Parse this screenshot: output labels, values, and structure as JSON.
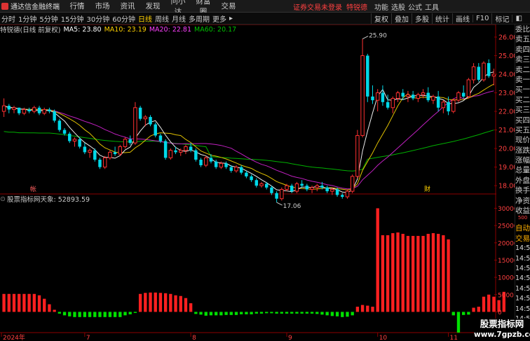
{
  "titlebar": {
    "app_name": "通达信金融终端",
    "menu": [
      "行情",
      "市场",
      "资讯",
      "发现",
      "问小达",
      "财富圈",
      "交易"
    ],
    "warning": "证券交易未登录",
    "stock_name": "特锐德",
    "right_menu": [
      "功能",
      "选股",
      "公式",
      "工具"
    ],
    "guest": "游客"
  },
  "toolbar": {
    "periods": [
      "分时",
      "1分钟",
      "5分钟",
      "15分钟",
      "30分钟",
      "60分钟",
      "日线",
      "周线",
      "月线",
      "多周期",
      "更多"
    ],
    "active_period": "日线",
    "right_tools": [
      "复权",
      "叠加",
      "多股",
      "统计",
      "画线",
      "F10",
      "标记"
    ]
  },
  "main_chart_info": {
    "title": "特锐德(日线 前复权)",
    "ma5": "MA5: 23.80",
    "ma10": "MA10: 23.19",
    "ma20": "MA20: 22.81",
    "ma60": "MA60: 20.17",
    "colors": {
      "ma5": "#ffffff",
      "ma10": "#ffd100",
      "ma20": "#ff40ff",
      "ma60": "#00c000"
    }
  },
  "sub_chart_info": {
    "title": "股票指标网",
    "indicator": "天象: 52893.59"
  },
  "chart_data": [
    {
      "type": "candlestick",
      "title": "特锐德(日线 前复权)",
      "y_ticks": [
        "26.00",
        "25.00",
        "24.00",
        "23.00",
        "22.00",
        "21.00",
        "20.00",
        "19.00",
        "18.00",
        "17.00"
      ],
      "ylim": [
        16.8,
        26.3
      ],
      "annotations": {
        "high": "25.90",
        "low": "17.06"
      },
      "markers": [
        "帐",
        "财"
      ],
      "candles": [
        [
          22.0,
          22.7,
          21.7,
          22.3
        ],
        [
          22.3,
          22.4,
          21.9,
          22.1
        ],
        [
          22.1,
          22.3,
          21.9,
          22.2
        ],
        [
          22.2,
          22.2,
          21.8,
          21.9
        ],
        [
          21.9,
          22.2,
          21.8,
          22.1
        ],
        [
          22.1,
          22.2,
          21.9,
          22.0
        ],
        [
          22.0,
          22.3,
          21.9,
          22.2
        ],
        [
          22.2,
          22.3,
          21.8,
          21.9
        ],
        [
          21.9,
          22.2,
          21.8,
          22.1
        ],
        [
          22.1,
          22.2,
          21.9,
          22.0
        ],
        [
          22.0,
          22.1,
          21.4,
          21.5
        ],
        [
          21.5,
          21.6,
          20.9,
          21.0
        ],
        [
          21.0,
          21.1,
          20.7,
          20.8
        ],
        [
          20.8,
          20.9,
          20.3,
          20.4
        ],
        [
          20.4,
          20.6,
          20.1,
          20.5
        ],
        [
          20.5,
          20.6,
          20.0,
          20.1
        ],
        [
          20.1,
          20.3,
          19.7,
          19.8
        ],
        [
          19.8,
          20.0,
          19.5,
          19.9
        ],
        [
          19.9,
          20.0,
          19.3,
          19.4
        ],
        [
          19.4,
          19.5,
          18.9,
          19.0
        ],
        [
          19.0,
          19.6,
          18.9,
          19.5
        ],
        [
          19.5,
          19.9,
          19.4,
          19.8
        ],
        [
          19.8,
          20.1,
          19.6,
          19.7
        ],
        [
          19.7,
          20.2,
          19.6,
          20.1
        ],
        [
          20.1,
          20.6,
          20.0,
          20.5
        ],
        [
          20.5,
          20.7,
          20.2,
          20.3
        ],
        [
          20.3,
          22.5,
          20.2,
          22.2
        ],
        [
          22.2,
          22.3,
          21.5,
          21.6
        ],
        [
          21.6,
          21.8,
          21.2,
          21.7
        ],
        [
          21.7,
          21.8,
          21.2,
          21.3
        ],
        [
          21.3,
          21.4,
          20.6,
          20.7
        ],
        [
          20.7,
          20.8,
          20.3,
          20.4
        ],
        [
          20.4,
          20.5,
          19.4,
          19.5
        ],
        [
          19.5,
          20.0,
          19.4,
          19.9
        ],
        [
          19.9,
          20.1,
          19.7,
          19.8
        ],
        [
          19.8,
          20.0,
          19.6,
          19.9
        ],
        [
          19.9,
          20.2,
          19.7,
          20.1
        ],
        [
          20.1,
          20.3,
          19.8,
          19.9
        ],
        [
          19.9,
          20.0,
          19.3,
          19.4
        ],
        [
          19.4,
          19.5,
          19.0,
          19.1
        ],
        [
          19.1,
          19.6,
          19.0,
          19.5
        ],
        [
          19.5,
          19.7,
          19.2,
          19.3
        ],
        [
          19.3,
          19.4,
          18.9,
          19.0
        ],
        [
          19.0,
          19.3,
          18.9,
          19.2
        ],
        [
          19.2,
          19.3,
          18.9,
          19.0
        ],
        [
          19.0,
          19.1,
          18.7,
          18.8
        ],
        [
          18.8,
          19.1,
          18.7,
          19.0
        ],
        [
          19.0,
          19.1,
          18.6,
          18.7
        ],
        [
          18.7,
          18.8,
          18.4,
          18.5
        ],
        [
          18.5,
          18.6,
          18.2,
          18.3
        ],
        [
          18.3,
          18.4,
          17.9,
          18.0
        ],
        [
          18.0,
          18.2,
          17.9,
          18.1
        ],
        [
          18.1,
          18.2,
          17.8,
          17.9
        ],
        [
          17.9,
          18.0,
          17.5,
          17.6
        ],
        [
          17.6,
          17.7,
          17.1,
          17.3
        ],
        [
          17.3,
          17.9,
          17.2,
          17.8
        ],
        [
          17.8,
          18.1,
          17.7,
          18.0
        ],
        [
          18.0,
          18.1,
          17.6,
          17.7
        ],
        [
          17.7,
          18.2,
          17.6,
          18.1
        ],
        [
          18.1,
          18.3,
          17.9,
          18.0
        ],
        [
          18.0,
          18.1,
          17.7,
          17.8
        ],
        [
          17.8,
          18.0,
          17.6,
          17.9
        ],
        [
          17.9,
          18.1,
          17.7,
          18.0
        ],
        [
          18.0,
          18.2,
          17.8,
          17.9
        ],
        [
          17.9,
          18.0,
          17.6,
          17.7
        ],
        [
          17.7,
          17.9,
          17.5,
          17.8
        ],
        [
          17.8,
          17.9,
          17.4,
          17.5
        ],
        [
          17.5,
          17.6,
          17.3,
          17.4
        ],
        [
          17.4,
          17.8,
          17.3,
          17.7
        ],
        [
          17.7,
          18.6,
          17.6,
          18.5
        ],
        [
          18.5,
          21.0,
          18.4,
          20.7
        ],
        [
          20.7,
          25.9,
          20.6,
          25.0
        ],
        [
          25.0,
          25.1,
          22.5,
          22.8
        ],
        [
          22.8,
          23.4,
          22.4,
          22.6
        ],
        [
          22.6,
          23.2,
          22.0,
          23.0
        ],
        [
          23.0,
          23.4,
          22.3,
          22.5
        ],
        [
          22.5,
          22.9,
          22.1,
          22.2
        ],
        [
          22.2,
          22.8,
          21.9,
          22.7
        ],
        [
          22.7,
          23.1,
          22.5,
          23.0
        ],
        [
          23.0,
          23.2,
          22.6,
          22.8
        ],
        [
          22.8,
          23.1,
          22.5,
          22.9
        ],
        [
          22.9,
          23.1,
          22.6,
          22.7
        ],
        [
          22.7,
          23.0,
          22.5,
          22.9
        ],
        [
          22.9,
          23.2,
          22.7,
          23.0
        ],
        [
          23.0,
          23.3,
          22.5,
          22.6
        ],
        [
          22.6,
          22.9,
          22.4,
          22.8
        ],
        [
          22.8,
          23.1,
          22.0,
          22.2
        ],
        [
          22.2,
          22.6,
          21.9,
          22.5
        ],
        [
          22.5,
          22.8,
          21.8,
          22.0
        ],
        [
          22.0,
          22.7,
          21.9,
          22.6
        ],
        [
          22.6,
          23.1,
          22.5,
          23.0
        ],
        [
          23.0,
          23.4,
          22.7,
          22.8
        ],
        [
          22.8,
          23.8,
          22.7,
          23.7
        ],
        [
          23.7,
          24.6,
          23.5,
          24.4
        ],
        [
          24.4,
          24.6,
          23.6,
          23.7
        ],
        [
          23.7,
          24.7,
          23.6,
          24.6
        ],
        [
          24.6,
          24.8,
          23.8,
          23.9
        ],
        [
          23.9,
          24.3,
          23.4,
          24.0
        ]
      ],
      "ma_series": {
        "MA5": "white",
        "MA10": "yellow",
        "MA20": "magenta",
        "MA60": "green"
      }
    },
    {
      "type": "bar",
      "title": "天象",
      "y_ticks": [
        "30000",
        "25000",
        "20000",
        "15000",
        "10000",
        "5000",
        "0"
      ],
      "ylim": [
        -6000,
        30500
      ],
      "x_labels": [
        "2024年",
        "7",
        "8",
        "9",
        "10",
        "11"
      ],
      "values": [
        5200,
        5200,
        5200,
        5200,
        5200,
        5200,
        5200,
        4800,
        3800,
        2200,
        600,
        -500,
        -1000,
        -1300,
        -1500,
        -1500,
        -1500,
        -1500,
        -1500,
        -1500,
        -1500,
        -1500,
        -1500,
        -1500,
        -1000,
        -700,
        -300,
        5200,
        5500,
        5600,
        5600,
        5500,
        5400,
        5200,
        4800,
        4600,
        4000,
        2500,
        -600,
        -800,
        -1100,
        -1000,
        -1000,
        -1000,
        -900,
        -900,
        -900,
        -700,
        -700,
        -700,
        -500,
        -500,
        -400,
        -400,
        -500,
        -500,
        -500,
        -500,
        -500,
        -500,
        -500,
        -500,
        -600,
        -800,
        -1000,
        -1200,
        -1300,
        -1500,
        -1400,
        -1000,
        1500,
        2000,
        1800,
        1500,
        30000,
        22200,
        22200,
        22800,
        23000,
        22600,
        22000,
        22000,
        22000,
        22000,
        22600,
        22800,
        22600,
        22200,
        21000,
        -1000,
        -6000,
        -900,
        -800,
        1200,
        1500,
        4400,
        5000,
        4400,
        3400,
        5800
      ]
    }
  ],
  "side_panel": {
    "labels": [
      "委比",
      "卖五",
      "卖四",
      "卖三",
      "卖二",
      "卖一",
      "买一",
      "买二",
      "买三",
      "买四",
      "买五",
      "现价",
      "涨跌",
      "涨幅",
      "总量",
      "外盘",
      "换手",
      "净资",
      "收益"
    ],
    "labels2": [
      "自动",
      "交易"
    ],
    "times": [
      "14:56",
      "14:56",
      "14:56",
      "14:56",
      "14:56",
      "14:56",
      "14:56",
      "14:56",
      "14:56",
      "14:56"
    ],
    "small_value": "500"
  },
  "watermark": {
    "line1": "股票指标网",
    "line2": "www.7gpzb.com"
  }
}
